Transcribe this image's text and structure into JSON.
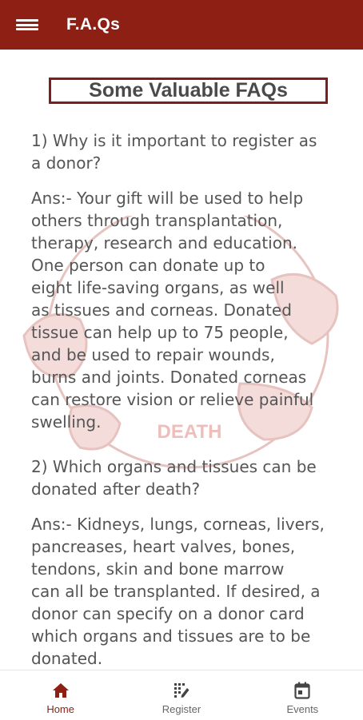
{
  "appbar": {
    "title": "F.A.Qs",
    "menu_icon": "hamburger-menu-icon"
  },
  "colors": {
    "primary": "#8d1f14",
    "text": "#555555",
    "watermark": "#e9c7c4"
  },
  "watermark_text": "DEATH",
  "heading": "Some Valuable FAQs",
  "faqs": [
    {
      "q_lines": [
        "1) Why is it important to register as",
        "a donor?"
      ],
      "a_lines": [
        "Ans:- Your gift will be used to help",
        "others through transplantation,",
        "therapy, research and education.",
        "One person can donate up to",
        "eight life-saving organs, as well",
        "as tissues and corneas. Donated",
        "tissue can help up to 75 people,",
        "and be used to repair wounds,",
        "burns and joints. Donated corneas",
        "can restore vision or relieve painful",
        "swelling."
      ]
    },
    {
      "q_lines": [
        "2) Which organs and tissues can be",
        "donated after death?"
      ],
      "a_lines": [
        "Ans:- Kidneys, lungs, corneas, livers,",
        "pancreases, heart valves, bones,",
        "tendons, skin and bone marrow",
        "can all be transplanted. If desired, a",
        "donor can specify on a donor card",
        "which organs and tissues are to be",
        "donated."
      ]
    }
  ],
  "bottom_nav": [
    {
      "label": "Home",
      "icon": "home-icon",
      "active": true
    },
    {
      "label": "Register",
      "icon": "register-icon",
      "active": false
    },
    {
      "label": "Events",
      "icon": "calendar-icon",
      "active": false
    }
  ]
}
